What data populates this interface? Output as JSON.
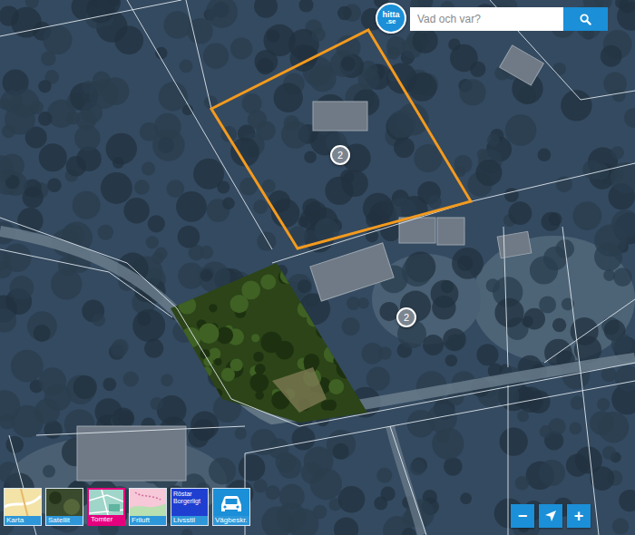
{
  "logo": {
    "name": "hitta",
    "suffix": ".se"
  },
  "search": {
    "placeholder": "Vad och var?"
  },
  "map": {
    "markers": [
      {
        "label": "2"
      },
      {
        "label": "2"
      }
    ]
  },
  "layers": [
    {
      "label": "Karta",
      "kind": "karta",
      "selected": false
    },
    {
      "label": "Satellit",
      "kind": "satellit",
      "selected": false
    },
    {
      "label": "Tomter",
      "kind": "tomter",
      "selected": true
    },
    {
      "label": "Friluft",
      "kind": "friluft",
      "selected": false
    },
    {
      "label": "Livsstil",
      "kind": "livsstil",
      "selected": false,
      "thumb_text": "Röstar Borgerligt"
    },
    {
      "label": "Vägbeskr.",
      "kind": "route",
      "selected": false
    }
  ],
  "zoom": {
    "out": "−",
    "in": "+"
  }
}
